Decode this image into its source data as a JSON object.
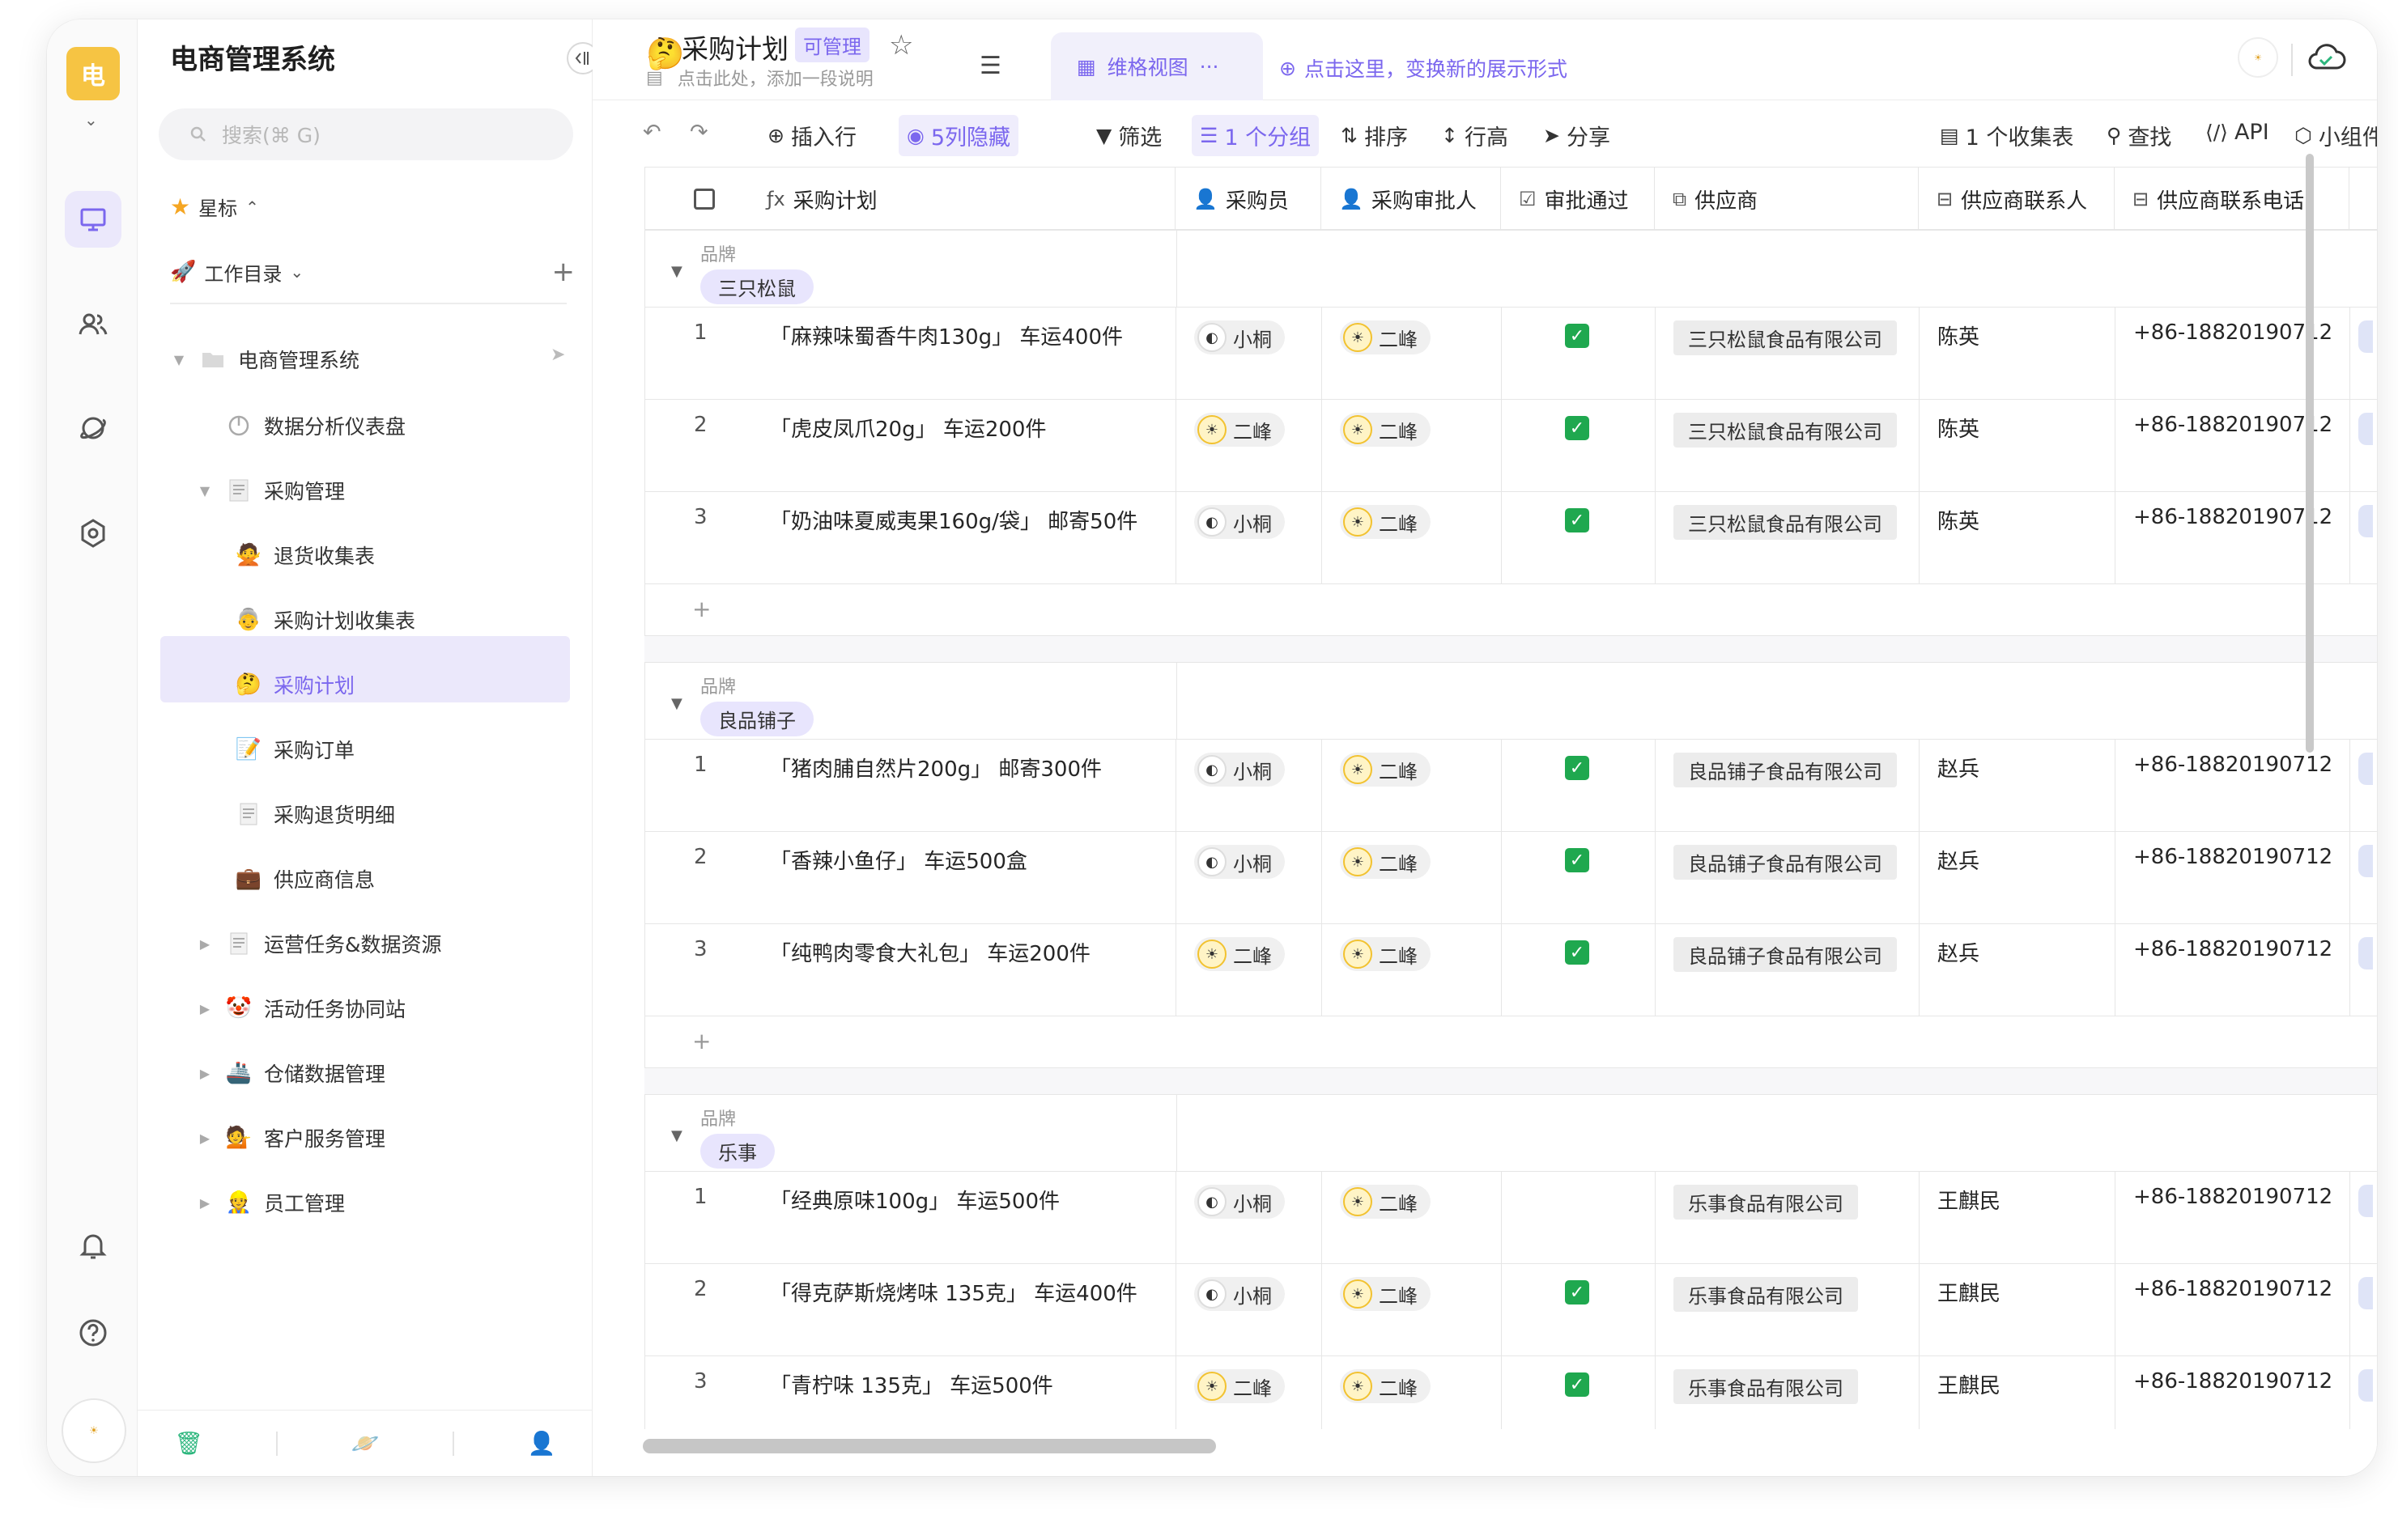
{
  "sidebar": {
    "space_badge": "电",
    "title": "电商管理系统",
    "search_placeholder": "搜索(⌘ G)",
    "starred_label": "星标",
    "workdir_label": "工作目录",
    "tree": [
      {
        "label": "电商管理系统",
        "icon": "folder-icon"
      },
      {
        "label": "数据分析仪表盘",
        "icon": "dashboard-icon"
      },
      {
        "label": "采购管理",
        "icon": "folder-doc-icon"
      },
      {
        "label": "退货收集表",
        "icon": "person-emoji-icon"
      },
      {
        "label": "采购计划收集表",
        "icon": "person-emoji-icon"
      },
      {
        "label": "采购计划",
        "icon": "thinking-emoji-icon"
      },
      {
        "label": "采购订单",
        "icon": "memo-emoji-icon"
      },
      {
        "label": "采购退货明细",
        "icon": "doc-icon"
      },
      {
        "label": "供应商信息",
        "icon": "briefcase-emoji-icon"
      },
      {
        "label": "运营任务&数据资源",
        "icon": "doc-icon"
      },
      {
        "label": "活动任务协同站",
        "icon": "clown-emoji-icon"
      },
      {
        "label": "仓储数据管理",
        "icon": "ship-emoji-icon"
      },
      {
        "label": "客户服务管理",
        "icon": "person-emoji-icon"
      },
      {
        "label": "员工管理",
        "icon": "worker-emoji-icon"
      }
    ]
  },
  "header": {
    "title": "采购计划",
    "badge": "可管理",
    "description": "点击此处，添加一段说明",
    "view_tab": "维格视图",
    "view_hint": "点击这里，变换新的展示形式"
  },
  "toolbar": {
    "insert_row": "插入行",
    "hidden_cols": "5列隐藏",
    "filter": "筛选",
    "group": "1 个分组",
    "sort": "排序",
    "row_height": "行高",
    "share": "分享",
    "form": "1 个收集表",
    "find": "查找",
    "api": "API",
    "widget": "小组件"
  },
  "columns": [
    "采购计划",
    "采购员",
    "采购审批人",
    "审批通过",
    "供应商",
    "供应商联系人",
    "供应商联系电话"
  ],
  "group_field_label": "品牌",
  "groups": [
    {
      "name": "三只松鼠",
      "rows": [
        {
          "no": "1",
          "plan": "「麻辣味蜀香牛肉130g」 车运400件",
          "buyer": "小桐",
          "approver": "二峰",
          "approved": "✓",
          "supplier": "三只松鼠食品有限公司",
          "contact": "陈英",
          "phone": "+86-18820190712"
        },
        {
          "no": "2",
          "plan": "「虎皮凤爪20g」 车运200件",
          "buyer": "二峰",
          "approver": "二峰",
          "approved": "✓",
          "supplier": "三只松鼠食品有限公司",
          "contact": "陈英",
          "phone": "+86-18820190712"
        },
        {
          "no": "3",
          "plan": "「奶油味夏威夷果160g/袋」 邮寄50件",
          "buyer": "小桐",
          "approver": "二峰",
          "approved": "✓",
          "supplier": "三只松鼠食品有限公司",
          "contact": "陈英",
          "phone": "+86-18820190712"
        }
      ]
    },
    {
      "name": "良品铺子",
      "rows": [
        {
          "no": "1",
          "plan": "「猪肉脯自然片200g」 邮寄300件",
          "buyer": "小桐",
          "approver": "二峰",
          "approved": "✓",
          "supplier": "良品铺子食品有限公司",
          "contact": "赵兵",
          "phone": "+86-18820190712"
        },
        {
          "no": "2",
          "plan": "「香辣小鱼仔」 车运500盒",
          "buyer": "小桐",
          "approver": "二峰",
          "approved": "✓",
          "supplier": "良品铺子食品有限公司",
          "contact": "赵兵",
          "phone": "+86-18820190712"
        },
        {
          "no": "3",
          "plan": "「纯鸭肉零食大礼包」 车运200件",
          "buyer": "二峰",
          "approver": "二峰",
          "approved": "✓",
          "supplier": "良品铺子食品有限公司",
          "contact": "赵兵",
          "phone": "+86-18820190712"
        }
      ]
    },
    {
      "name": "乐事",
      "rows": [
        {
          "no": "1",
          "plan": "「经典原味100g」 车运500件",
          "buyer": "小桐",
          "approver": "二峰",
          "approved": "",
          "supplier": "乐事食品有限公司",
          "contact": "王麒民",
          "phone": "+86-18820190712"
        },
        {
          "no": "2",
          "plan": "「得克萨斯烧烤味 135克」 车运400件",
          "buyer": "小桐",
          "approver": "二峰",
          "approved": "✓",
          "supplier": "乐事食品有限公司",
          "contact": "王麒民",
          "phone": "+86-18820190712"
        },
        {
          "no": "3",
          "plan": "「青柠味 135克」 车运500件",
          "buyer": "二峰",
          "approver": "二峰",
          "approved": "✓",
          "supplier": "乐事食品有限公司",
          "contact": "王麒民",
          "phone": "+86-18820190712"
        }
      ]
    }
  ],
  "add_row_symbol": "+",
  "colors": {
    "accent": "#7b67ee",
    "accent_bg": "#ebe8fb",
    "badge": "#f6c443",
    "check": "#1fa84f"
  }
}
